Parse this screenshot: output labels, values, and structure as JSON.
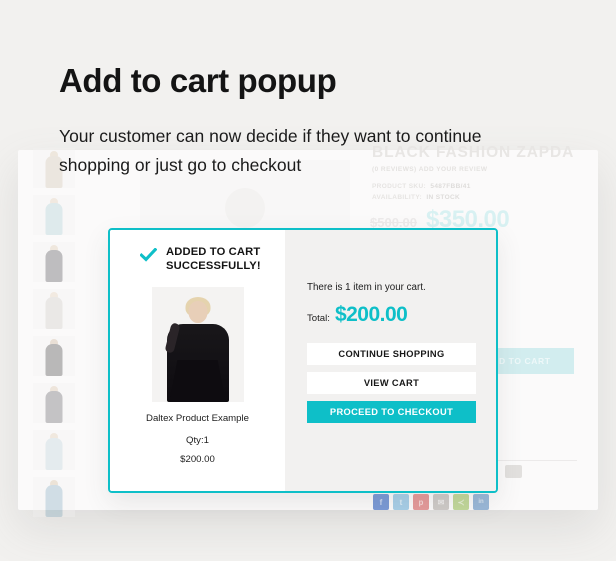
{
  "page": {
    "background_color": "#f2f1ef",
    "accent_color": "#0ebfc8"
  },
  "heading": {
    "title": "Add to cart popup",
    "subtitle": "Your customer can now decide if they want to continue shopping or just go to checkout"
  },
  "background_mock": {
    "product_title": "BLACK FASHION ZAPDA",
    "reviews": "(0 REVIEWS)   ADD YOUR REVIEW",
    "sku_label": "PRODUCT SKU:",
    "sku_value": "5487FBB/41",
    "availability_label": "AVAILABILITY:",
    "availability_value": "IN STOCK",
    "old_price": "$500.00",
    "new_price": "$350.00",
    "add_to_cart_label": "ADD TO CART",
    "social_icons": [
      {
        "name": "facebook-icon",
        "glyph": "f",
        "color": "#7b9ad6"
      },
      {
        "name": "twitter-icon",
        "glyph": "t",
        "color": "#a8cfe8"
      },
      {
        "name": "pinterest-icon",
        "glyph": "p",
        "color": "#e59a9a"
      },
      {
        "name": "email-icon",
        "glyph": "✉",
        "color": "#cfcbc8"
      },
      {
        "name": "share-icon",
        "glyph": "≺",
        "color": "#c2d89a"
      },
      {
        "name": "linkedin-icon",
        "glyph": "in",
        "color": "#9ab8d8"
      }
    ],
    "thumbnail_count": 8
  },
  "popup": {
    "success_message": "ADDED TO CART SUCCESSFULLY!",
    "check_icon": "check-icon",
    "product": {
      "name": "Daltex Product Example",
      "qty": "Qty:1",
      "price": "$200.00",
      "image_alt": "product-image"
    },
    "cart_summary": "There is 1 item in your cart.",
    "total_label": "Total:",
    "total_value": "$200.00",
    "buttons": {
      "continue_shopping": "CONTINUE SHOPPING",
      "view_cart": "VIEW CART",
      "proceed_to_checkout": "PROCEED TO CHECKOUT"
    }
  }
}
